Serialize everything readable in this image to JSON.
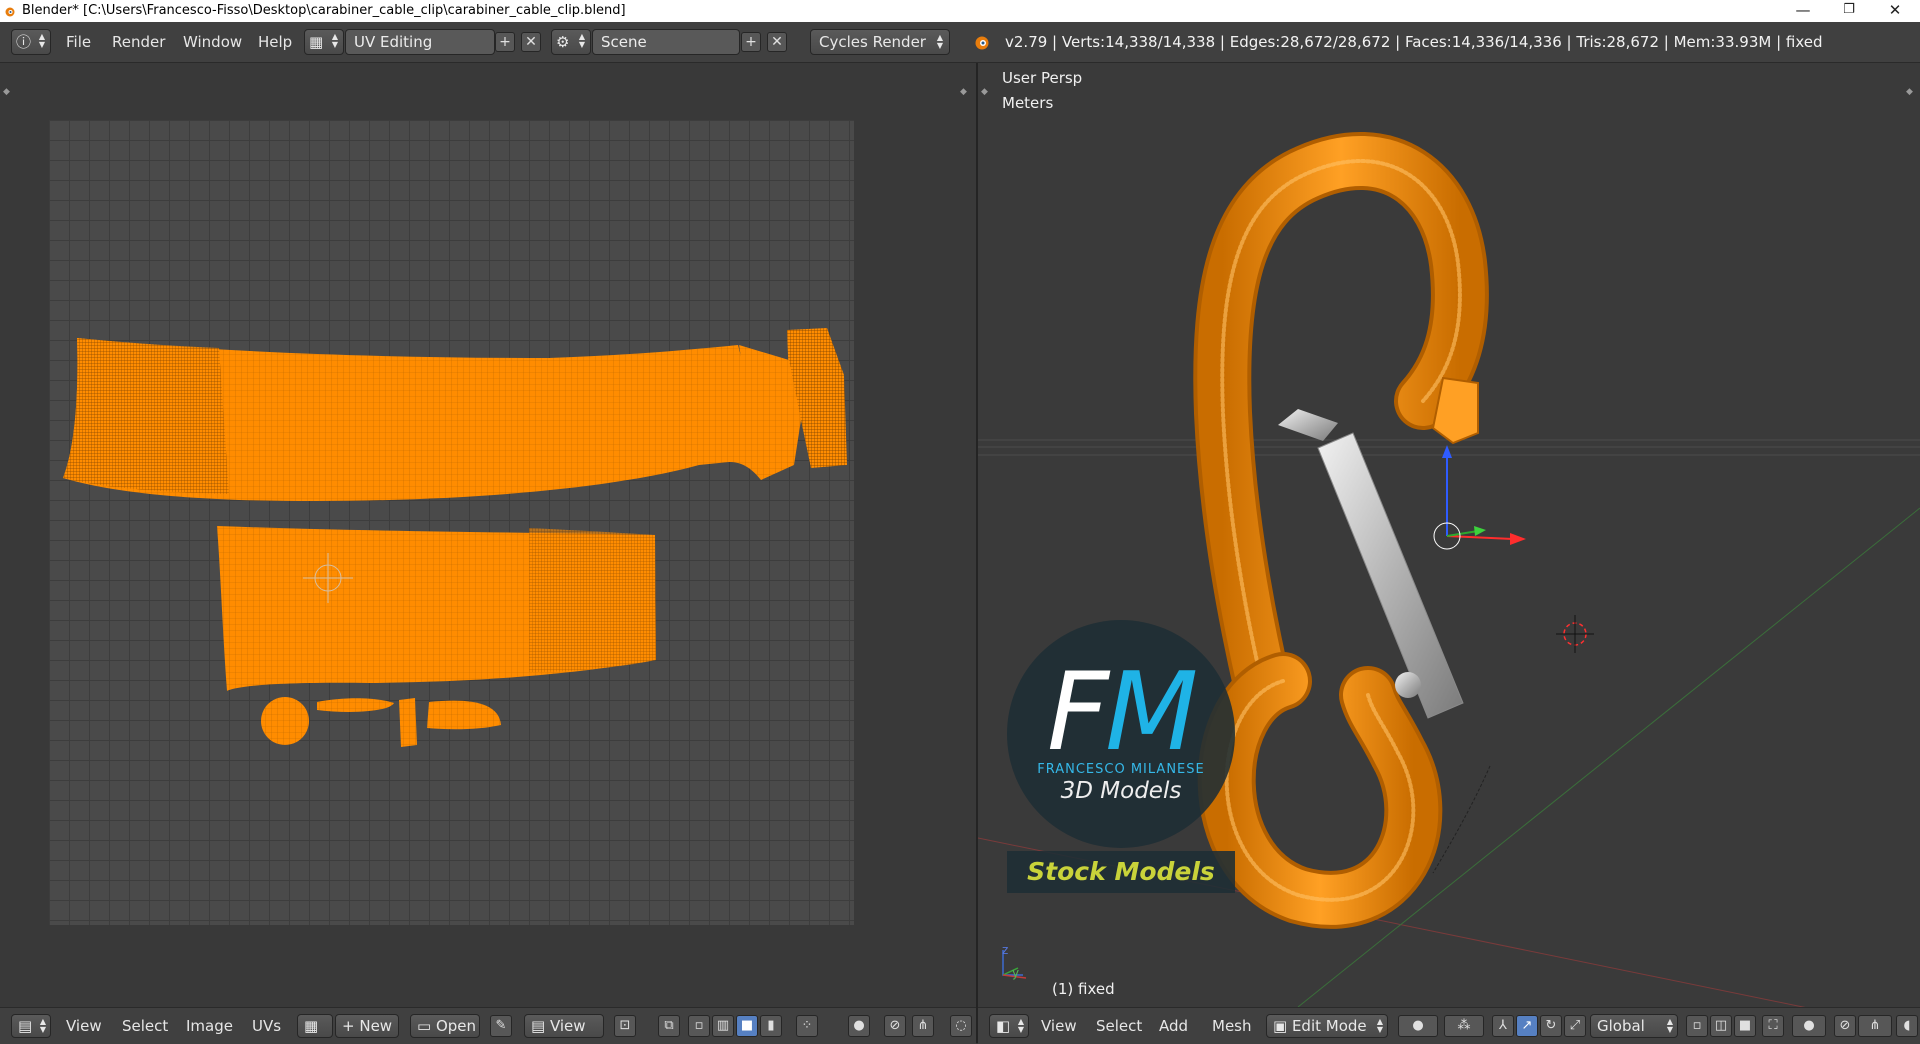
{
  "window": {
    "title": "Blender* [C:\\Users\\Francesco-Fisso\\Desktop\\carabiner_cable_clip\\carabiner_cable_clip.blend]",
    "minimize": "—",
    "maximize": "❐",
    "close": "✕"
  },
  "header": {
    "menus": [
      "File",
      "Render",
      "Window",
      "Help"
    ],
    "layout": "UV Editing",
    "scene": "Scene",
    "engine": "Cycles Render",
    "stats": "v2.79 | Verts:14,338/14,338 | Edges:28,672/28,672 | Faces:14,336/14,336 | Tris:28,672 | Mem:33.93M | fixed"
  },
  "viewport": {
    "view_name": "User Persp",
    "units": "Meters",
    "object_label": "(1) fixed",
    "axis_z": "z",
    "axis_y": "y"
  },
  "watermark": {
    "letter_f": "F",
    "letter_m": "M",
    "brand": "FRANCESCO MILANESE",
    "subtitle": "3D Models",
    "stock": "Stock Models"
  },
  "uv_footer": {
    "menus": [
      "View",
      "Select",
      "Image",
      "UVs"
    ],
    "new_label": "New",
    "open_label": "Open",
    "view_label": "View"
  },
  "view3d_footer": {
    "menus": [
      "View",
      "Select",
      "Add",
      "Mesh"
    ],
    "mode": "Edit Mode",
    "orientation": "Global"
  },
  "colors": {
    "accent_orange": "#ff8c00",
    "bg": "#393939",
    "header": "#404040",
    "active_button": "#5680c2"
  }
}
